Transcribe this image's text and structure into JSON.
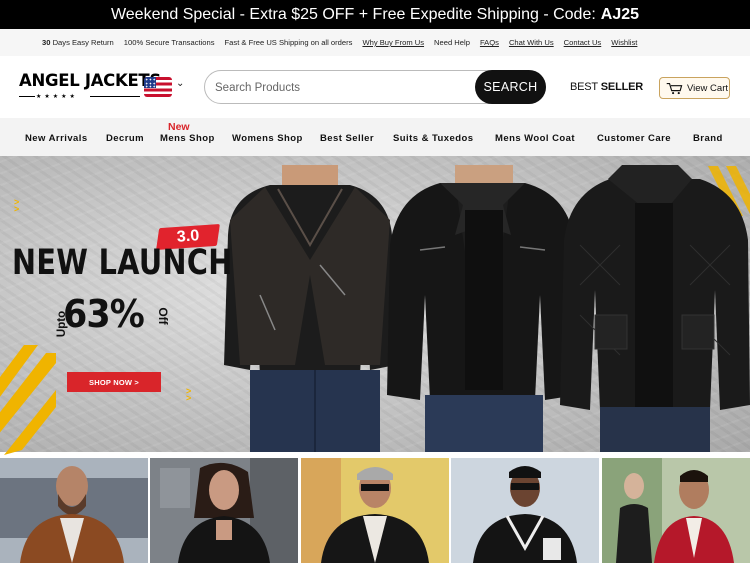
{
  "promo": {
    "text": "Weekend Special - Extra $25 OFF + Free Expedite Shipping - Code:",
    "code": "AJ25"
  },
  "utility_bar": {
    "returns_days": "30",
    "returns_text": "Days Easy Return",
    "secure": "100% Secure Transactions",
    "shipping": "Fast & Free US Shipping on all orders",
    "links": [
      "Why Buy From Us",
      "Need Help",
      "FAQs",
      "Chat With Us",
      "Contact Us",
      "Wishlist"
    ]
  },
  "header": {
    "logo": "ANGEL JACKETS",
    "logo_stars": "★★★★★",
    "search_placeholder": "Search Products",
    "search_button": "SEARCH",
    "best_seller_light": "BEST",
    "best_seller_bold": "SELLER",
    "cart_label": "View Cart",
    "flag": "us-flag"
  },
  "nav": {
    "new_tag": "New",
    "items": [
      "New Arrivals",
      "Decrum",
      "Mens Shop",
      "Womens Shop",
      "Best Seller",
      "Suits & Tuxedos",
      "Mens Wool Coat",
      "Customer Care",
      "Brand"
    ]
  },
  "hero": {
    "badge": "3.0",
    "title": "NEW LAUNCH",
    "upto": "Upto",
    "discount": "63%",
    "off": "Off",
    "cta": "SHOP NOW >"
  },
  "colors": {
    "accent": "#d9252a",
    "dark": "#111111",
    "nav_bg": "#f3f3f3",
    "stripe_yellow": "#f0b400"
  }
}
